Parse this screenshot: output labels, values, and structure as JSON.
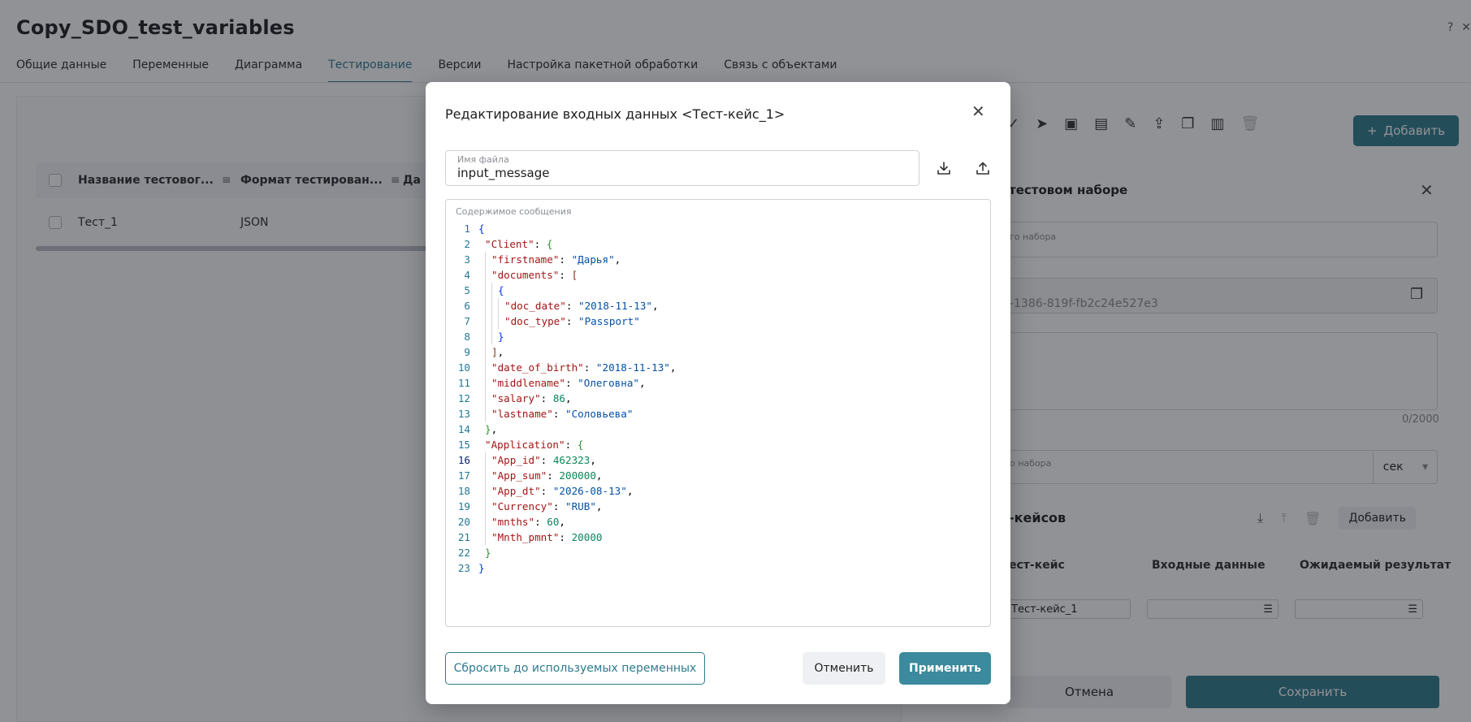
{
  "page": {
    "title": "Copy_SDO_test_variables",
    "tabs": [
      {
        "label": "Общие данные",
        "active": false
      },
      {
        "label": "Переменные",
        "active": false
      },
      {
        "label": "Диаграмма",
        "active": false
      },
      {
        "label": "Тестирование",
        "active": true
      },
      {
        "label": "Версии",
        "active": false
      },
      {
        "label": "Настройка пакетной обработки",
        "active": false
      },
      {
        "label": "Связь с объектами",
        "active": false
      }
    ]
  },
  "table": {
    "columns": [
      "Название тестовог...",
      "Формат тестирован...",
      "Да"
    ],
    "rows": [
      {
        "name": "Тест_1",
        "format": "JSON"
      }
    ]
  },
  "right_panel": {
    "add_label": "Добавить",
    "section_title": "тестовом наборе",
    "name_placeholder": "го набора",
    "id_value": "-1386-819f-fb2c24e527e3",
    "counter": "0/2000",
    "time_placeholder": "о набора",
    "time_unit": "сек",
    "cases_title": "-кейсов",
    "cases_add_label": "Добавить",
    "cases_columns": [
      "ест-кейс",
      "Входные данные",
      "Ожидаемый результат"
    ],
    "cases_rows": [
      {
        "name": "Тест-кейс_1"
      }
    ],
    "cancel_label": "Отмена",
    "save_label": "Сохранить"
  },
  "modal": {
    "title": "Редактирование входных данных <Тест-кейс_1>",
    "file_label": "Имя файла",
    "file_value": "input_message",
    "editor_label": "Содержимое сообщения",
    "active_line": 16,
    "code_lines": [
      "{",
      "  \"Client\": {",
      "    \"firstname\": \"Дарья\",",
      "    \"documents\": [",
      "      {",
      "        \"doc_date\": \"2018-11-13\",",
      "        \"doc_type\": \"Passport\"",
      "      }",
      "    ],",
      "    \"date_of_birth\": \"2018-11-13\",",
      "    \"middlename\": \"Олеговна\",",
      "    \"salary\": 86,",
      "    \"lastname\": \"Соловьева\"",
      "  },",
      "  \"Application\": {",
      "    \"App_id\": 462323,",
      "    \"App_sum\": 200000,",
      "    \"App_dt\": \"2026-08-13\",",
      "    \"Currency\": \"RUB\",",
      "    \"mnths\": 60,",
      "    \"Mnth_pmnt\": 20000",
      "  }",
      "}"
    ],
    "reset_label": "Сбросить до используемых переменных",
    "cancel_label": "Отменить",
    "apply_label": "Применить"
  },
  "colors": {
    "accent": "#2f7b8d",
    "apply_button": "#3b8a9d",
    "overlay": "rgba(25,28,36,0.48)"
  },
  "icons": {
    "download": "download-icon",
    "upload": "upload-icon",
    "close": "close-icon"
  }
}
